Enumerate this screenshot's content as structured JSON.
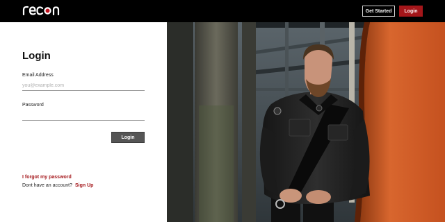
{
  "header": {
    "logo_text": "recon",
    "get_started_label": "Get Started",
    "login_label": "Login"
  },
  "login_form": {
    "title": "Login",
    "email_label": "Email Address",
    "email_placeholder": "you@example.com",
    "email_value": "",
    "password_label": "Password",
    "password_value": "",
    "submit_label": "Login"
  },
  "links": {
    "forgot_password": "I forgot my password",
    "no_account_text": "Dont have an account?",
    "sign_up": "Sign Up"
  },
  "hero": {
    "subject": "man in black leather uniform standing under a pier beside an orange wall"
  },
  "colors": {
    "brand_red": "#a4161a",
    "topbar_bg": "#000000",
    "submit_bg": "#555555",
    "accent_orange": "#d0622c"
  }
}
